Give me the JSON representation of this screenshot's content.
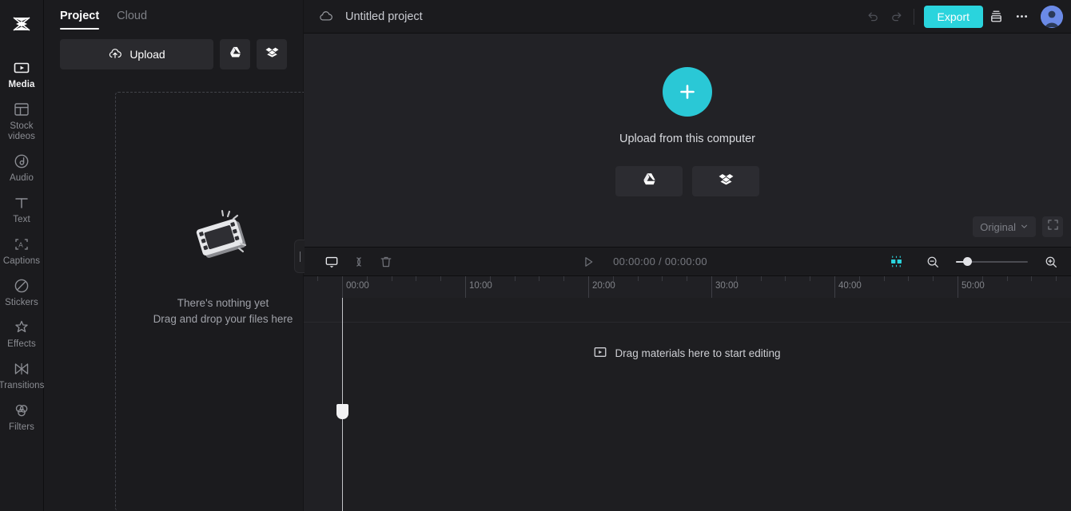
{
  "app": {
    "logo_name": "capcut-logo"
  },
  "rail": {
    "items": [
      {
        "label": "Media",
        "icon": "media-icon",
        "active": true
      },
      {
        "label": "Stock\nvideos",
        "icon": "stock-videos-icon",
        "active": false
      },
      {
        "label": "Audio",
        "icon": "audio-icon",
        "active": false
      },
      {
        "label": "Text",
        "icon": "text-icon",
        "active": false
      },
      {
        "label": "Captions",
        "icon": "captions-icon",
        "active": false
      },
      {
        "label": "Stickers",
        "icon": "stickers-icon",
        "active": false
      },
      {
        "label": "Effects",
        "icon": "effects-icon",
        "active": false
      },
      {
        "label": "Transitions",
        "icon": "transitions-icon",
        "active": false
      },
      {
        "label": "Filters",
        "icon": "filters-icon",
        "active": false
      }
    ]
  },
  "panel": {
    "tabs": [
      {
        "label": "Project",
        "active": true
      },
      {
        "label": "Cloud",
        "active": false
      }
    ],
    "upload_button": "Upload",
    "google_drive_icon": "google-drive-icon",
    "dropbox_icon": "dropbox-icon",
    "empty_state": {
      "icon": "film-strip-icon",
      "line1": "There's nothing yet",
      "line2": "Drag and drop your files here"
    }
  },
  "topbar": {
    "cloud_icon": "cloud-icon",
    "project_title": "Untitled project",
    "undo_icon": "undo-icon",
    "redo_icon": "redo-icon",
    "export_label": "Export",
    "layout_icon": "layout-icon",
    "more_icon": "more-options-icon",
    "avatar_icon": "user-avatar"
  },
  "preview": {
    "plus_icon": "plus-icon",
    "upload_label": "Upload from this computer",
    "google_drive_icon": "google-drive-icon",
    "dropbox_icon": "dropbox-icon",
    "ratio_value": "Original",
    "chevron_icon": "chevron-down-icon",
    "expand_icon": "fullscreen-icon"
  },
  "timeline": {
    "tools": [
      {
        "name": "record-screen-icon",
        "active": true
      },
      {
        "name": "split-icon",
        "active": false
      },
      {
        "name": "delete-icon",
        "active": false
      }
    ],
    "play_icon": "play-icon",
    "current_time": "00:00:00",
    "total_time": "00:00:00",
    "time_separator": "/",
    "fit_icon": "fit-to-timeline-icon",
    "zoom_out_icon": "zoom-out-icon",
    "zoom_in_icon": "zoom-in-icon",
    "zoom_value": 11,
    "ruler_labels": [
      "00:00",
      "10:00",
      "20:00",
      "30:00",
      "40:00",
      "50:00"
    ],
    "ruler_positions": [
      0,
      154,
      308,
      462,
      616,
      770
    ],
    "playhead_position": 0,
    "hint_icon": "media-clip-icon",
    "hint_text": "Drag materials here to start editing"
  },
  "colors": {
    "accent": "#2ad4dd",
    "accent_circle": "#2ac8d6",
    "bg_dark": "#1b1b1e",
    "bg_preview": "#222226",
    "bg_panel_btn": "#2a2a2e",
    "text_primary": "#ffffff",
    "text_muted": "#8b8d93",
    "avatar_blue": "#6b8ae6"
  }
}
